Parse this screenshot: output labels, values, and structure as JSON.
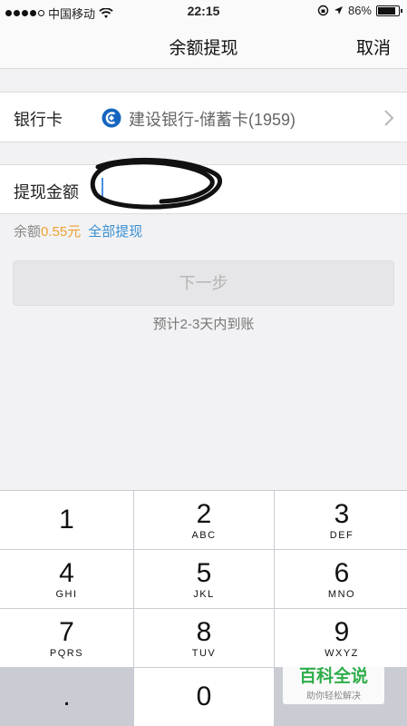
{
  "status_bar": {
    "carrier": "中国移动",
    "time": "22:15",
    "battery": "86%",
    "battery_level": 0.86,
    "signal_bars": 4,
    "signal_total": 5
  },
  "nav": {
    "title": "余额提现",
    "cancel": "取消"
  },
  "bank": {
    "label": "银行卡",
    "name": "建设银行-储蓄卡(1959)",
    "icon": "ccb-bank-icon",
    "icon_color": "#1565c0"
  },
  "amount": {
    "label": "提现金额",
    "value": ""
  },
  "balance": {
    "prefix": "余额",
    "amount": "0.55元",
    "withdraw_all": "全部提现"
  },
  "next_button": "下一步",
  "estimate": "预计2-3天内到账",
  "keypad": {
    "keys": [
      {
        "num": "1",
        "letters": ""
      },
      {
        "num": "2",
        "letters": "ABC"
      },
      {
        "num": "3",
        "letters": "DEF"
      },
      {
        "num": "4",
        "letters": "GHI"
      },
      {
        "num": "5",
        "letters": "JKL"
      },
      {
        "num": "6",
        "letters": "MNO"
      },
      {
        "num": "7",
        "letters": "PQRS"
      },
      {
        "num": "8",
        "letters": "TUV"
      },
      {
        "num": "9",
        "letters": "WXYZ"
      },
      {
        "num": ".",
        "letters": ""
      },
      {
        "num": "0",
        "letters": ""
      },
      {
        "num": "",
        "letters": ""
      }
    ]
  },
  "watermark": {
    "title": "百科全说",
    "subtitle": "助你轻松解决"
  },
  "colors": {
    "accent_orange": "#f0a030",
    "link_blue": "#3a8fd0",
    "cursor_blue": "#4a90e2"
  }
}
